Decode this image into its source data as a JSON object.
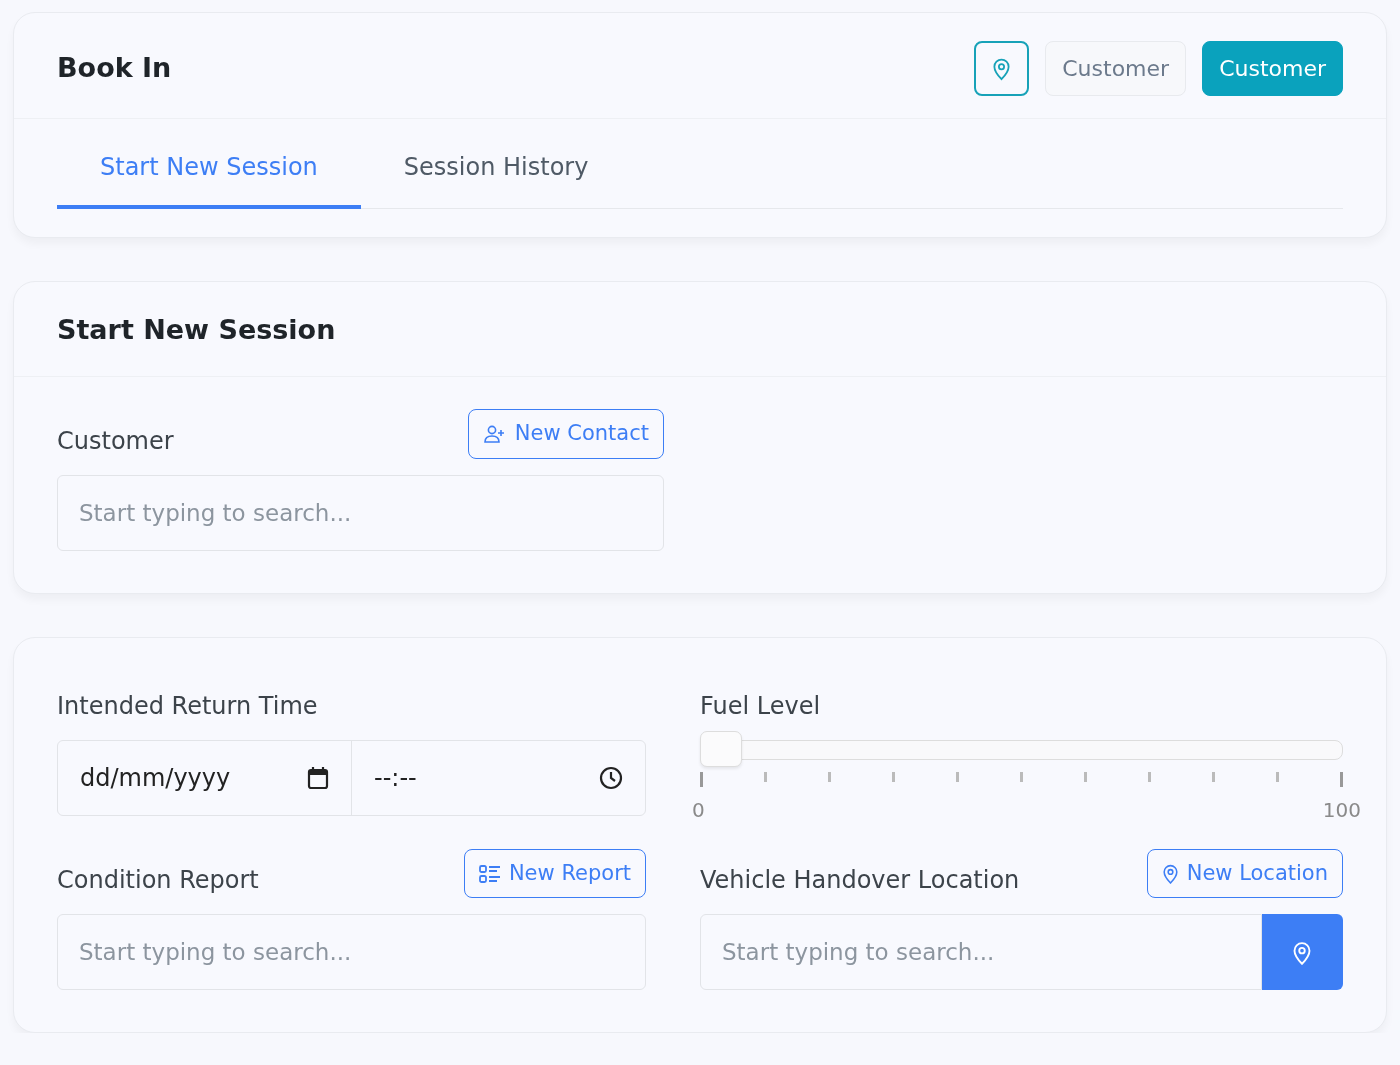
{
  "header": {
    "title": "Book In",
    "buttons": [
      {
        "kind": "icon"
      },
      {
        "kind": "light",
        "label": "Customer"
      },
      {
        "kind": "primary",
        "label": "Customer"
      }
    ]
  },
  "tabs": [
    {
      "label": "Start New Session",
      "selected": true
    },
    {
      "label": "Session History",
      "selected": false
    }
  ],
  "session_card": {
    "title": "Start New Session",
    "customer": {
      "label": "Customer",
      "button": "New Contact",
      "placeholder": "Start typing to search..."
    }
  },
  "details_card": {
    "return_time": {
      "label": "Intended Return Time",
      "date_value": "dd/mm/yyyy",
      "time_value": "--:--"
    },
    "fuel": {
      "label": "Fuel Level",
      "level": 0,
      "min_label": "0",
      "max_label": "100"
    },
    "condition": {
      "label": "Condition Report",
      "button": "New Report",
      "placeholder": "Start typing to search..."
    },
    "location": {
      "label": "Vehicle Handover Location",
      "button": "New Location",
      "placeholder": "Start typing to search..."
    }
  }
}
